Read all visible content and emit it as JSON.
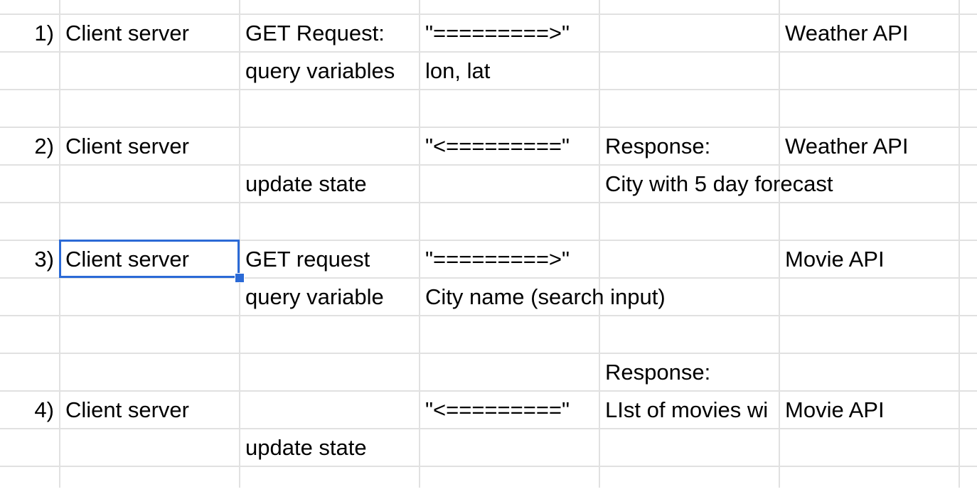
{
  "rows": [
    {
      "num": "1)",
      "a": "Client server",
      "b": "GET Request:",
      "c": "\"=========>\"",
      "d": "",
      "e": "Weather API"
    },
    {
      "num": "",
      "a": "",
      "b": "query variables",
      "c": "lon, lat",
      "d": "",
      "e": ""
    },
    {
      "num": "",
      "a": "",
      "b": "",
      "c": "",
      "d": "",
      "e": ""
    },
    {
      "num": "2)",
      "a": "Client server",
      "b": "",
      "c": "\"<=========\"",
      "d": "Response:",
      "e": "Weather API"
    },
    {
      "num": "",
      "a": "",
      "b": "update state",
      "c": "",
      "d": "City with 5 day forecast",
      "e": ""
    },
    {
      "num": "",
      "a": "",
      "b": "",
      "c": "",
      "d": "",
      "e": ""
    },
    {
      "num": "3)",
      "a": "Client server",
      "b": "GET request",
      "c": "\"=========>\"",
      "d": "",
      "e": "Movie API"
    },
    {
      "num": "",
      "a": "",
      "b": "query variable",
      "c": "City name (search input)",
      "d": "",
      "e": ""
    },
    {
      "num": "",
      "a": "",
      "b": "",
      "c": "",
      "d": "",
      "e": ""
    },
    {
      "num": "",
      "a": "",
      "b": "",
      "c": "",
      "d": "Response:",
      "e": ""
    },
    {
      "num": "4)",
      "a": "Client server",
      "b": "",
      "c": "\"<=========\"",
      "d": "LIst of movies wi",
      "e": "Movie API"
    },
    {
      "num": "",
      "a": "",
      "b": "update state",
      "c": "",
      "d": "",
      "e": ""
    },
    {
      "num": "",
      "a": "",
      "b": "",
      "c": "",
      "d": "",
      "e": ""
    }
  ],
  "selection": {
    "row": 6,
    "col": "a"
  },
  "colors": {
    "gridline": "#e1e1e1",
    "selection": "#2b6ad6"
  }
}
